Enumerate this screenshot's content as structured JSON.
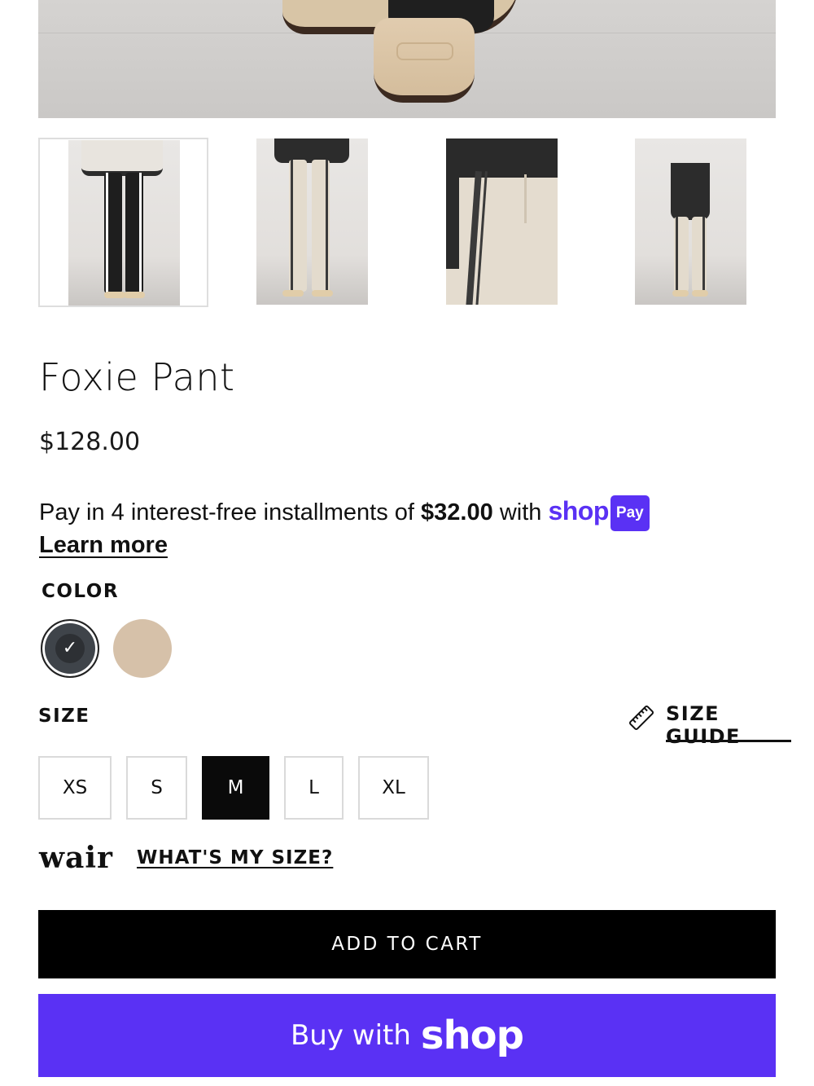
{
  "product": {
    "title": "Foxie Pant",
    "price": "$128.00"
  },
  "installments": {
    "prefix": "Pay in 4 interest-free installments of",
    "amount": "$32.00",
    "with": "with",
    "shop_word": "shop",
    "pay_badge": "Pay",
    "learn_more": "Learn more"
  },
  "color": {
    "label": "COLOR",
    "swatches": [
      {
        "name": "black",
        "hex": "#3f444a",
        "selected": true
      },
      {
        "name": "tan",
        "hex": "#d6c1a9",
        "selected": false
      }
    ]
  },
  "size": {
    "label": "SIZE",
    "guide_label": "SIZE GUIDE",
    "options": [
      "XS",
      "S",
      "M",
      "L",
      "XL"
    ],
    "selected": "M"
  },
  "wair": {
    "logo": "wair",
    "link": "WHAT'S MY SIZE?"
  },
  "actions": {
    "add_to_cart": "ADD TO CART",
    "buy_with": "Buy with",
    "buy_shop_logo": "shop"
  },
  "colors": {
    "shop_purple": "#5a31f4",
    "black": "#000000"
  }
}
